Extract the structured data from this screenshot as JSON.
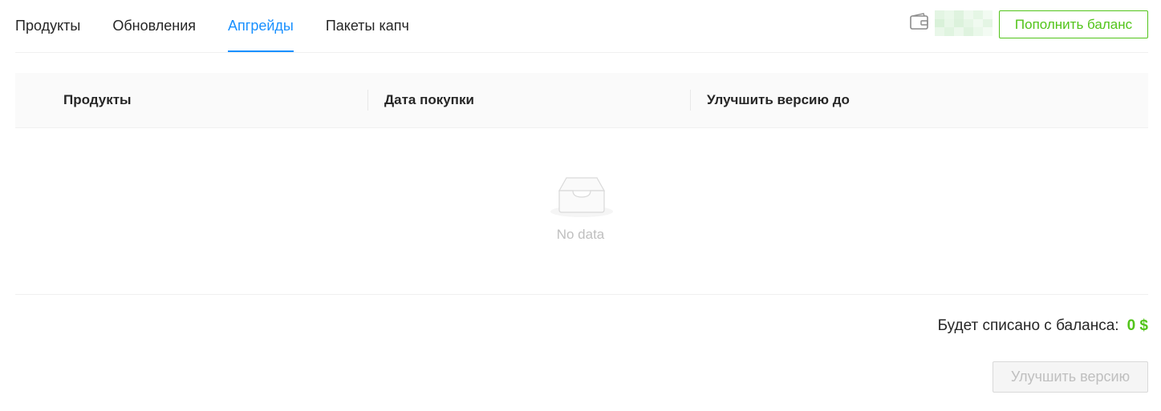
{
  "tabs": [
    {
      "label": "Продукты",
      "active": false
    },
    {
      "label": "Обновления",
      "active": false
    },
    {
      "label": "Апгрейды",
      "active": true
    },
    {
      "label": "Пакеты капч",
      "active": false
    }
  ],
  "header": {
    "wallet_icon": "wallet-icon",
    "topup_label": "Пополнить баланс"
  },
  "table": {
    "columns": [
      "Продукты",
      "Дата покупки",
      "Улучшить версию до"
    ],
    "rows": [],
    "empty_text": "No data",
    "empty_icon": "empty-inbox-icon"
  },
  "footer": {
    "charge_label": "Будет списано с баланса:",
    "charge_amount": "0 $",
    "upgrade_label": "Улучшить версию"
  },
  "colors": {
    "accent": "#1890ff",
    "success": "#52c41a",
    "header_bg": "#fafafa",
    "muted": "#bfbfbf"
  }
}
